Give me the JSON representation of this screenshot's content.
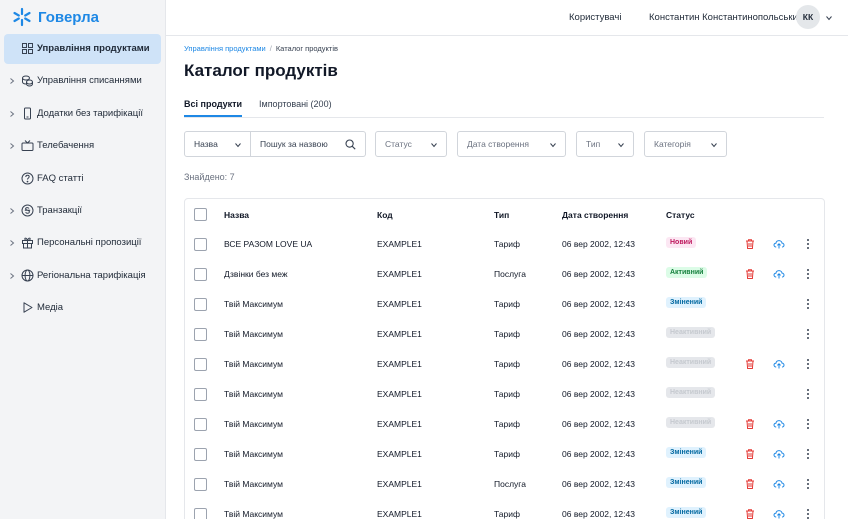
{
  "app": {
    "logo_text": "Говерла"
  },
  "sidebar": {
    "items": [
      {
        "label": "Управління продуктами",
        "icon": "grid-icon",
        "active": true,
        "chevron": false
      },
      {
        "label": "Управління списаннями",
        "icon": "coins-icon",
        "active": false,
        "chevron": true
      },
      {
        "label": "Додатки без тарифікації",
        "icon": "phone-icon",
        "active": false,
        "chevron": true
      },
      {
        "label": "Телебачення",
        "icon": "tv-icon",
        "active": false,
        "chevron": true
      },
      {
        "label": "FAQ статті",
        "icon": "question-icon",
        "active": false,
        "chevron": false
      },
      {
        "label": "Транзакції",
        "icon": "currency-icon",
        "active": false,
        "chevron": true
      },
      {
        "label": "Персональні пропозиції",
        "icon": "gift-icon",
        "active": false,
        "chevron": true
      },
      {
        "label": "Регіональна тарифікація",
        "icon": "globe-icon",
        "active": false,
        "chevron": true
      },
      {
        "label": "Медіа",
        "icon": "play-icon",
        "active": false,
        "chevron": false
      }
    ]
  },
  "header": {
    "users_link": "Користувачі",
    "user_name": "Константин Константинопольський",
    "avatar_initials": "КК"
  },
  "breadcrumb": {
    "parent": "Управління продуктами",
    "separator": "/",
    "current": "Каталог продуктів"
  },
  "page": {
    "title": "Каталог продуктів"
  },
  "tabs": {
    "all": "Всі продукти",
    "imported": "Імпортовані (200)"
  },
  "filters": {
    "name_select": "Назва",
    "search_placeholder": "Пошук за назвою",
    "status": "Статус",
    "created_date": "Дата створення",
    "type": "Тип",
    "category": "Категорія"
  },
  "found_text": "Знайдено: 7",
  "table": {
    "columns": {
      "name": "Назва",
      "code": "Код",
      "type": "Тип",
      "created": "Дата створення",
      "status": "Статус"
    },
    "rows": [
      {
        "name": "ВСЕ РАЗОМ LOVE UA",
        "code": "EXAMPLE1",
        "type": "Тариф",
        "created": "06 вер 2002, 12:43",
        "status": "Новий",
        "status_kind": "new",
        "actions": true
      },
      {
        "name": "Дзвінки без меж",
        "code": "EXAMPLE1",
        "type": "Послуга",
        "created": "06 вер 2002, 12:43",
        "status": "Активний",
        "status_kind": "active",
        "actions": true
      },
      {
        "name": "Твій Максимум",
        "code": "EXAMPLE1",
        "type": "Тариф",
        "created": "06 вер 2002, 12:43",
        "status": "Змінений",
        "status_kind": "changed",
        "actions": false
      },
      {
        "name": "Твій Максимум",
        "code": "EXAMPLE1",
        "type": "Тариф",
        "created": "06 вер 2002, 12:43",
        "status": "Неактивний",
        "status_kind": "inactive",
        "actions": false
      },
      {
        "name": "Твій Максимум",
        "code": "EXAMPLE1",
        "type": "Тариф",
        "created": "06 вер 2002, 12:43",
        "status": "Неактивний",
        "status_kind": "inactive",
        "actions": true
      },
      {
        "name": "Твій Максимум",
        "code": "EXAMPLE1",
        "type": "Тариф",
        "created": "06 вер 2002, 12:43",
        "status": "Неактивний",
        "status_kind": "inactive",
        "actions": false
      },
      {
        "name": "Твій Максимум",
        "code": "EXAMPLE1",
        "type": "Тариф",
        "created": "06 вер 2002, 12:43",
        "status": "Неактивний",
        "status_kind": "inactive",
        "actions": true
      },
      {
        "name": "Твій Максимум",
        "code": "EXAMPLE1",
        "type": "Тариф",
        "created": "06 вер 2002, 12:43",
        "status": "Змінений",
        "status_kind": "changed",
        "actions": true
      },
      {
        "name": "Твій Максимум",
        "code": "EXAMPLE1",
        "type": "Послуга",
        "created": "06 вер 2002, 12:43",
        "status": "Змінений",
        "status_kind": "changed",
        "actions": true
      },
      {
        "name": "Твій Максимум",
        "code": "EXAMPLE1",
        "type": "Тариф",
        "created": "06 вер 2002, 12:43",
        "status": "Змінений",
        "status_kind": "changed",
        "actions": true
      }
    ]
  },
  "colors": {
    "accent": "#1e88e5",
    "active_nav_bg": "#cfe3f8",
    "delete_icon": "#e53935",
    "upload_icon": "#1e88e5"
  }
}
